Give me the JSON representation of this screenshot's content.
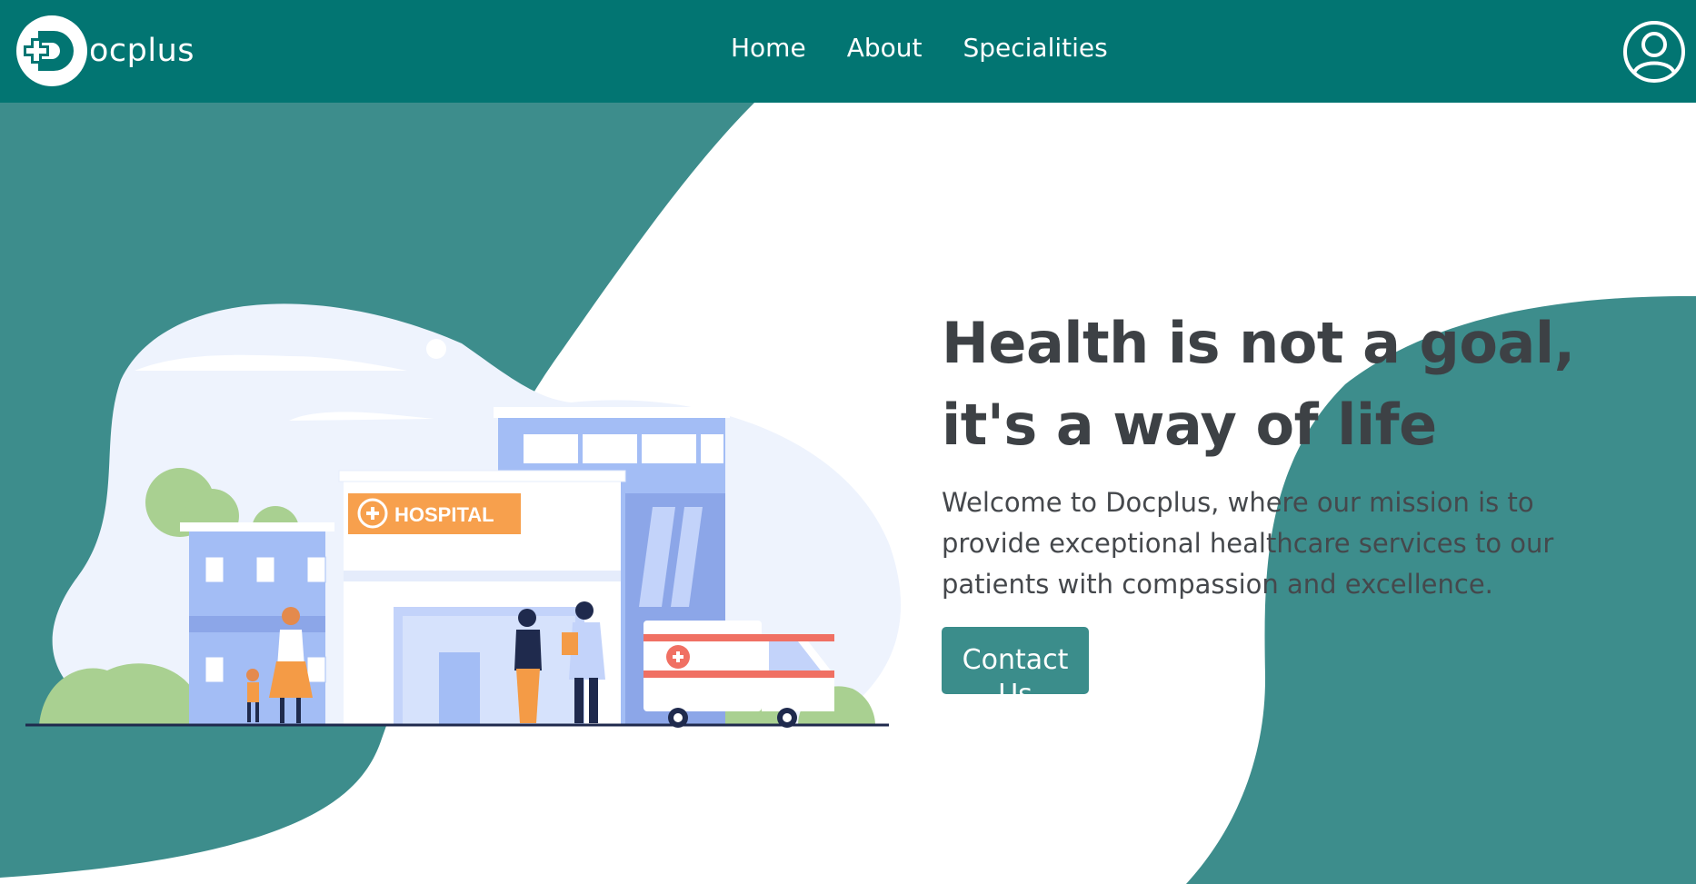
{
  "brand": {
    "name": "ocplus",
    "logo_icon": "docplus-d-cross-logo"
  },
  "nav": {
    "items": [
      {
        "label": "Home"
      },
      {
        "label": "About"
      },
      {
        "label": "Specialities"
      }
    ]
  },
  "header": {
    "profile_icon": "user-circle-icon"
  },
  "hero": {
    "headline": "Health is not a goal, it's a way of life",
    "subtext": "Welcome to Docplus, where our mission is to provide exceptional healthcare services to our patients with compassion and excellence.",
    "cta_label": "Contact Us",
    "illustration": {
      "sign_text": "HOSPITAL"
    }
  },
  "colors": {
    "nav_bg": "#027572",
    "teal_shape": "#3d8d8c",
    "button_bg": "#3b8d8b",
    "heading_text": "#3d4145",
    "body_text": "#45484c",
    "hospital_sign": "#f7a04d"
  }
}
